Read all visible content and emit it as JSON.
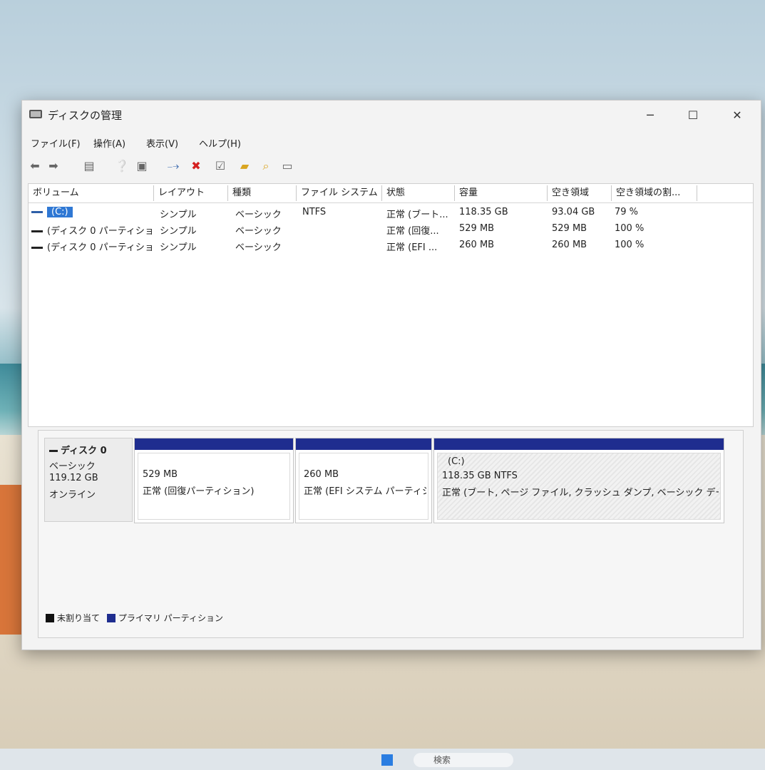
{
  "window": {
    "title": "ディスクの管理",
    "controls": {
      "minimize": "─",
      "maximize": "☐",
      "close": "✕"
    }
  },
  "menu": [
    "ファイル(F)",
    "操作(A)",
    "表示(V)",
    "ヘルプ(H)"
  ],
  "toolbar": {
    "icons": [
      "back-arrow-icon",
      "forward-arrow-icon",
      "properties-icon",
      "help-icon",
      "view-icon",
      "connect-icon",
      "delete-icon",
      "check-icon",
      "folder-up-icon",
      "search-icon",
      "settings-icon"
    ]
  },
  "columns": [
    "ボリューム",
    "レイアウト",
    "種類",
    "ファイル システム",
    "状態",
    "容量",
    "空き領域",
    "空き領域の割..."
  ],
  "volumes": [
    {
      "name": "(C:)",
      "layout": "シンプル",
      "type": "ベーシック",
      "fs": "NTFS",
      "status": "正常 (ブート...",
      "capacity": "118.35 GB",
      "free": "93.04 GB",
      "pct": "79 %"
    },
    {
      "name": "(ディスク 0 パーティショ...",
      "layout": "シンプル",
      "type": "ベーシック",
      "fs": "",
      "status": "正常 (回復...",
      "capacity": "529 MB",
      "free": "529 MB",
      "pct": "100 %"
    },
    {
      "name": "(ディスク 0 パーティショ...",
      "layout": "シンプル",
      "type": "ベーシック",
      "fs": "",
      "status": "正常 (EFI ...",
      "capacity": "260 MB",
      "free": "260 MB",
      "pct": "100 %"
    }
  ],
  "disk": {
    "name": "ディスク 0",
    "type": "ベーシック",
    "size": "119.12 GB",
    "state": "オンライン"
  },
  "partitions": [
    {
      "label": "",
      "size": "529 MB",
      "status": "正常 (回復パーティション)"
    },
    {
      "label": "",
      "size": "260 MB",
      "status": "正常 (EFI システム パーティショ"
    },
    {
      "label": "(C:)",
      "size": "118.35 GB NTFS",
      "status": "正常 (ブート, ページ ファイル, クラッシュ ダンプ, ベーシック データ パーティ"
    }
  ],
  "legend": {
    "unallocated": "未割り当て",
    "primary": "プライマリ パーティション",
    "colors": {
      "unallocated": "#111111",
      "primary": "#1f2d8f"
    }
  },
  "taskbar": {
    "search": "検索"
  }
}
